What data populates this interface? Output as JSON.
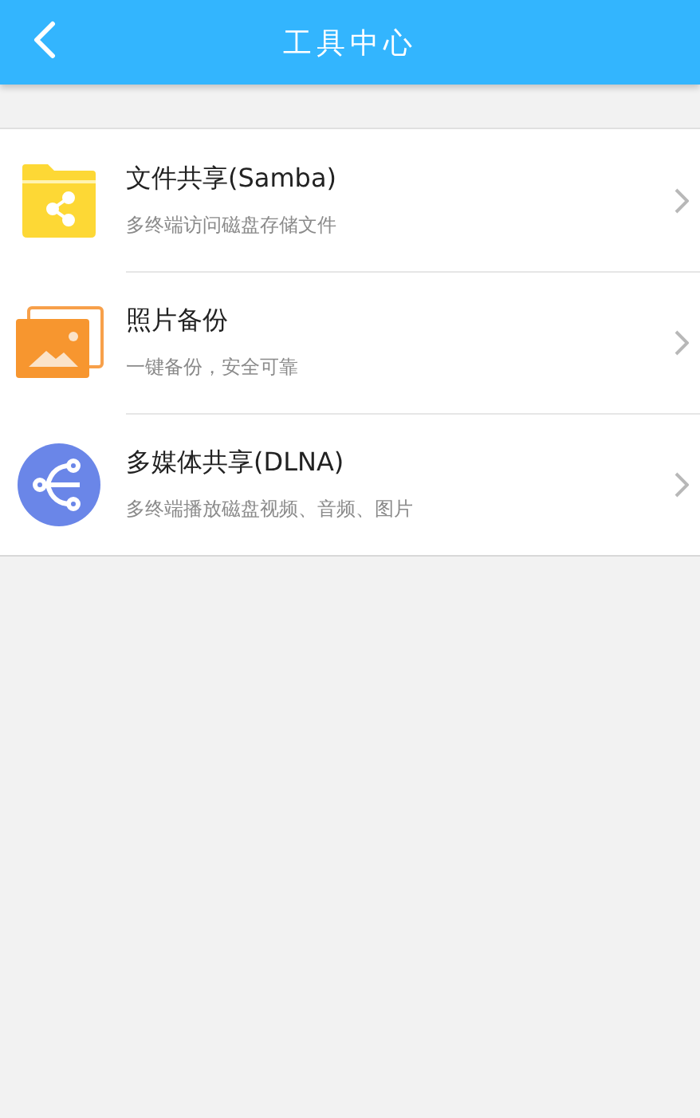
{
  "header": {
    "title": "工具中心"
  },
  "tools": [
    {
      "kind": "folder",
      "title": "文件共享(Samba)",
      "subtitle": "多终端访问磁盘存储文件"
    },
    {
      "kind": "photo",
      "title": "照片备份",
      "subtitle": "一键备份，安全可靠"
    },
    {
      "kind": "media",
      "title": "多媒体共享(DLNA)",
      "subtitle": "多终端播放磁盘视频、音频、图片"
    }
  ]
}
